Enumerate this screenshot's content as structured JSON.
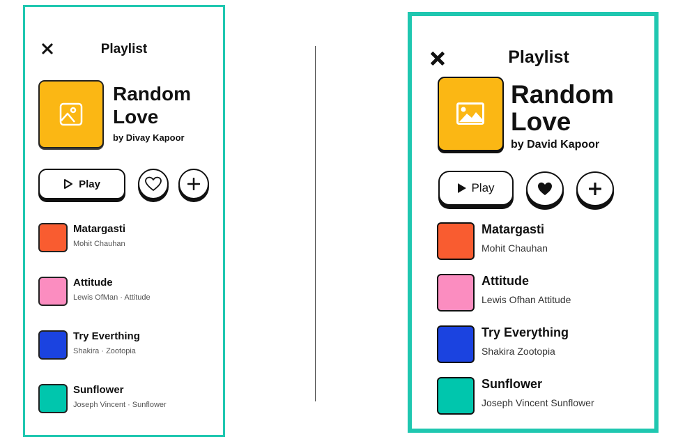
{
  "colors": {
    "panel_border": "#1fc7b0",
    "cover": "#fbb714",
    "ink": "#111111"
  },
  "left": {
    "close_icon": "close-icon",
    "title": "Playlist",
    "playlist_name_line1": "Random",
    "playlist_name_line2": "Love",
    "by": "by Divay Kapoor",
    "play_label": "Play",
    "like_icon": "heart-outline-icon",
    "add_icon": "plus-icon",
    "songs": [
      {
        "name": "Matargasti",
        "meta": "Mohit Chauhan",
        "color": "#f95c30"
      },
      {
        "name": "Attitude",
        "meta": "Lewis OfMan · Attitude",
        "color": "#fb8dc0"
      },
      {
        "name": "Try Everthing",
        "meta": "Shakira · Zootopia",
        "color": "#1b43e0"
      },
      {
        "name": "Sunflower",
        "meta": "Joseph Vincent · Sunflower",
        "color": "#00c6ad"
      }
    ]
  },
  "right": {
    "close_icon": "close-icon",
    "title": "Playlist",
    "playlist_name_line1": "Random",
    "playlist_name_line2": "Love",
    "by": "by David Kapoor",
    "play_label": "Play",
    "like_icon": "heart-filled-icon",
    "add_icon": "plus-icon",
    "songs": [
      {
        "name": "Matargasti",
        "meta": "Mohit Chauhan",
        "color": "#f95c30"
      },
      {
        "name": "Attitude",
        "meta": "Lewis Ofhan Attitude",
        "color": "#fb8dc0"
      },
      {
        "name": "Try Everything",
        "meta": "Shakira Zootopia",
        "color": "#1b43e0"
      },
      {
        "name": "Sunflower",
        "meta": "Joseph Vincent Sunflower",
        "color": "#00c6ad"
      }
    ]
  }
}
